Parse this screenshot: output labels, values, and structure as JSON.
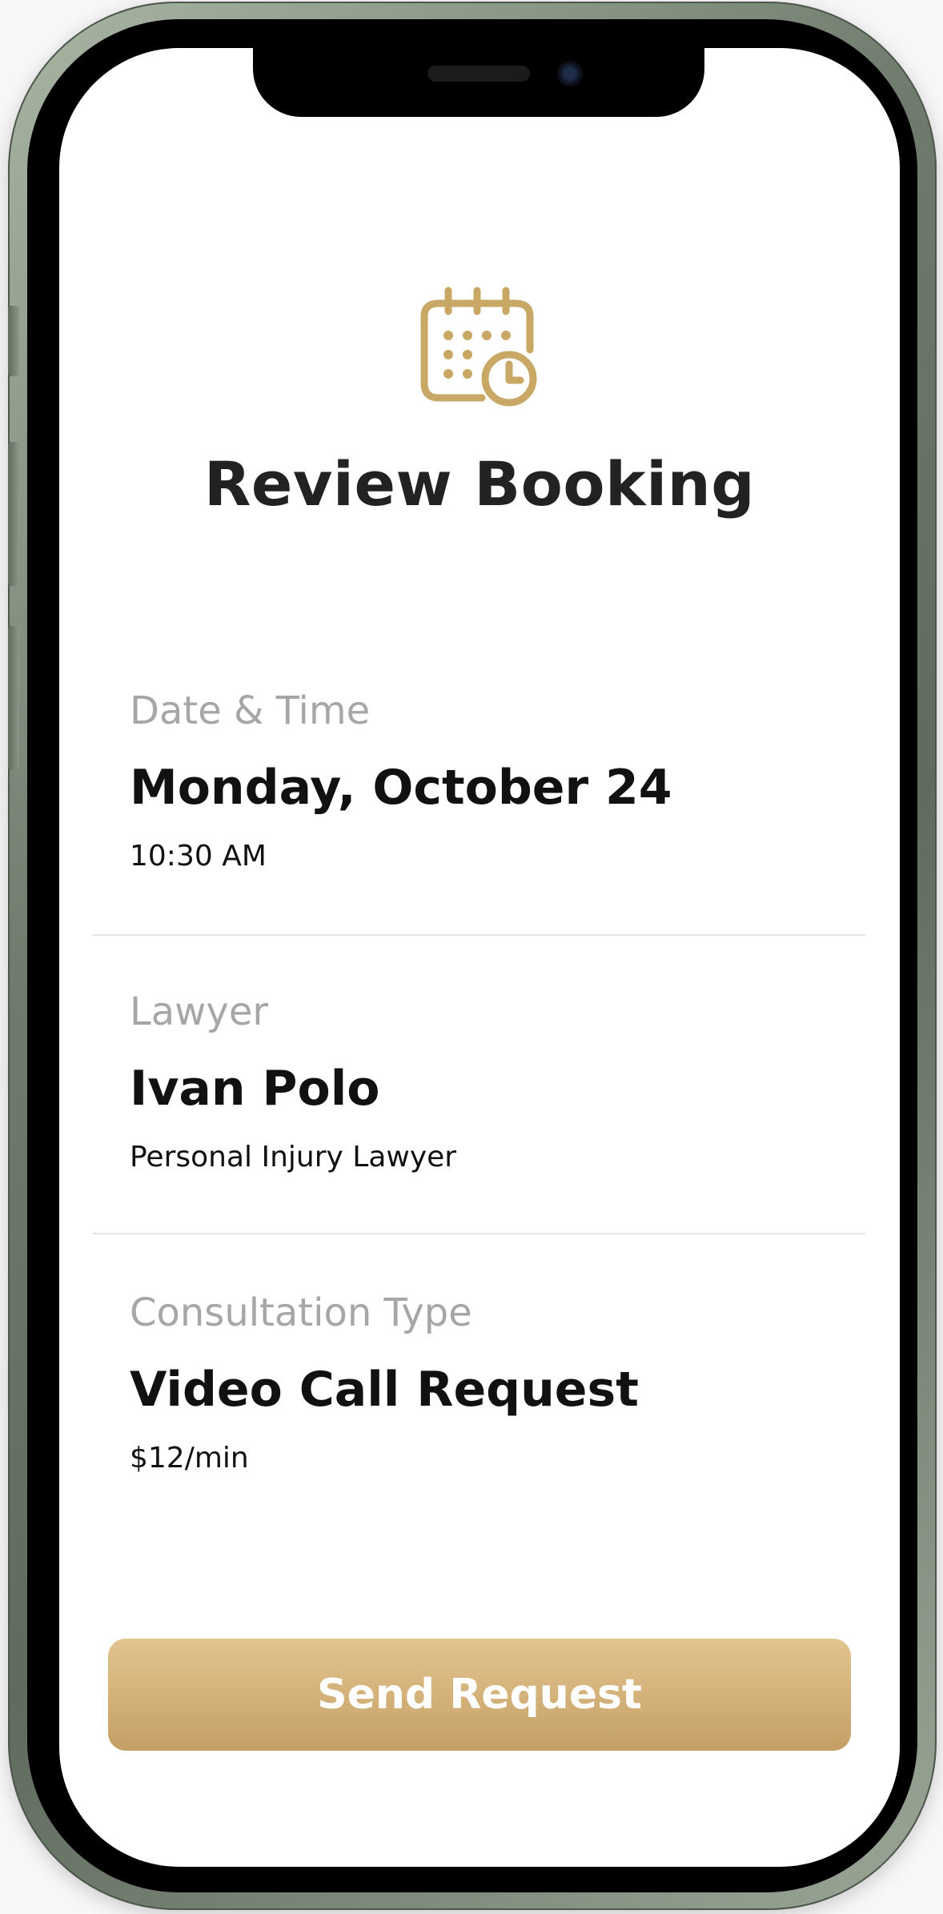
{
  "theme": {
    "accent": "#C9A764",
    "button_gradient_top": "#E2C48F",
    "button_gradient_bottom": "#C39F65",
    "label_gray": "#A6A6A6",
    "text_dark": "#111111",
    "divider": "#E4E4E4"
  },
  "header": {
    "icon": "calendar-clock-icon",
    "title": "Review Booking"
  },
  "sections": [
    {
      "label": "Date & Time",
      "value": "Monday, October 24",
      "sub": "10:30 AM"
    },
    {
      "label": "Lawyer",
      "value": "Ivan Polo",
      "sub": "Personal Injury Lawyer"
    },
    {
      "label": "Consultation Type",
      "value": "Video Call Request",
      "sub": "$12/min"
    }
  ],
  "actions": {
    "send_label": "Send Request"
  }
}
